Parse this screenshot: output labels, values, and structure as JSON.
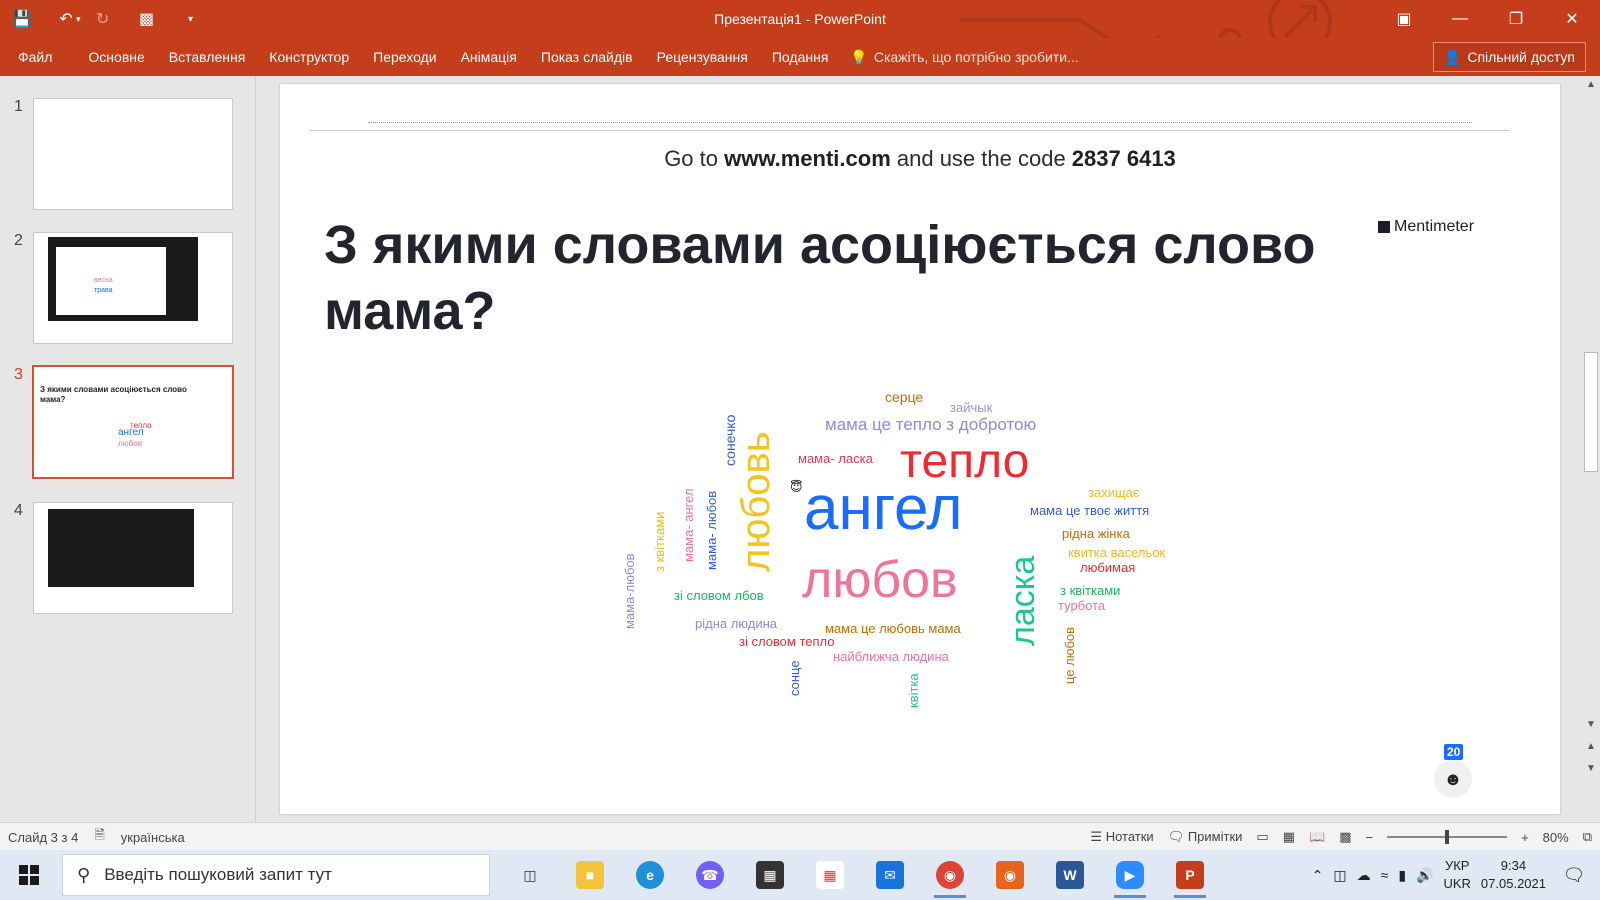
{
  "app": {
    "window_title": "Презентація1 - PowerPoint",
    "share_label": "Спільний доступ",
    "tell_me_placeholder": "Скажіть, що потрібно зробити..."
  },
  "ribbon": {
    "tabs": [
      "Файл",
      "Основне",
      "Вставлення",
      "Конструктор",
      "Переходи",
      "Анімація",
      "Показ слайдів",
      "Рецензування",
      "Подання"
    ]
  },
  "thumbnails": {
    "numbers": [
      "1",
      "2",
      "3",
      "4"
    ],
    "active_index": 3
  },
  "slide": {
    "code_prefix": "Go to ",
    "code_url": "www.menti.com",
    "code_middle": " and use the code ",
    "code_value": "2837 6413",
    "title": "З якими словами асоціюється слово мама?",
    "brand": "Mentimeter",
    "voters": "20",
    "words": [
      {
        "text": "серце",
        "color": "#c96b00"
      },
      {
        "text": "зайчык",
        "color": "#9b8fe0"
      },
      {
        "text": "мама це тепло з добротою",
        "color": "#8f86e6"
      },
      {
        "text": "сонечко",
        "color": "#2f5bd8"
      },
      {
        "text": "любовь",
        "color": "#f5c31e"
      },
      {
        "text": "мама- ласка",
        "color": "#e8344a"
      },
      {
        "text": "тепло",
        "color": "#f02a32"
      },
      {
        "text": "захищає",
        "color": "#f5b820"
      },
      {
        "text": "ангел",
        "color": "#196cff"
      },
      {
        "text": "мама це твоє життя",
        "color": "#2f5bd8"
      },
      {
        "text": "рідна жінка",
        "color": "#c96b00"
      },
      {
        "text": "квитка васельок",
        "color": "#f5b820"
      },
      {
        "text": "любимая",
        "color": "#f02a32"
      },
      {
        "text": "любов",
        "color": "#f0739a"
      },
      {
        "text": "ласка",
        "color": "#19c792"
      },
      {
        "text": "з квітками",
        "color": "#19b85c"
      },
      {
        "text": "турбота",
        "color": "#f0739a"
      },
      {
        "text": "мама-любов",
        "color": "#8f86e6"
      },
      {
        "text": "з квітками",
        "color": "#f5b820"
      },
      {
        "text": "мама- ангел",
        "color": "#f0739a"
      },
      {
        "text": "мама- любов",
        "color": "#2f5bd8"
      },
      {
        "text": "зі словом лбов",
        "color": "#19b85c"
      },
      {
        "text": "рідна людина",
        "color": "#8f86e6"
      },
      {
        "text": "зі словом тепло",
        "color": "#f02a32"
      },
      {
        "text": "мама це любовь мама",
        "color": "#c96b00"
      },
      {
        "text": "найближча людина",
        "color": "#f0739a"
      },
      {
        "text": "сонце",
        "color": "#2f5bd8"
      },
      {
        "text": "квітка",
        "color": "#19c792"
      },
      {
        "text": "це любов",
        "color": "#c96b00"
      }
    ]
  },
  "status": {
    "slide_of": "Слайд 3 з 4",
    "language": "українська",
    "notes": "Нотатки",
    "comments": "Примітки",
    "zoom": "80%"
  },
  "taskbar": {
    "search_placeholder": "Введіть пошуковий запит тут",
    "lang_top": "УКР",
    "lang_bottom": "UKR",
    "time": "9:34",
    "date": "07.05.2021"
  },
  "colors": {
    "accent": "#c43e1c",
    "brand_blue": "#196cff"
  }
}
